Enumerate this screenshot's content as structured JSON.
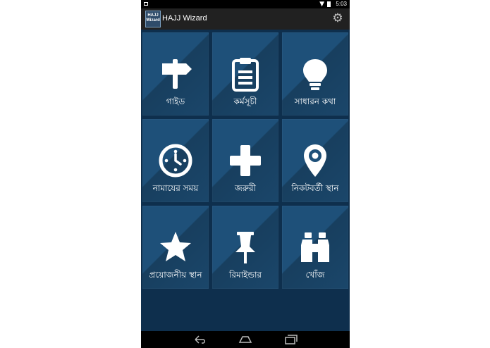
{
  "status_bar": {
    "time": "5:03"
  },
  "action_bar": {
    "logo_text": "HAJJ Wizard",
    "title": "HAJJ Wizard",
    "settings_icon": "gear-icon"
  },
  "tiles": [
    {
      "label": "গাইড",
      "icon": "signpost-icon"
    },
    {
      "label": "কর্মসূচী",
      "icon": "clipboard-icon"
    },
    {
      "label": "সাধারন কথা",
      "icon": "lightbulb-icon"
    },
    {
      "label": "নামাযের সময়",
      "icon": "clock-icon"
    },
    {
      "label": "জরুরী",
      "icon": "plus-icon"
    },
    {
      "label": "নিকটবর্তী স্থান",
      "icon": "location-pin-icon"
    },
    {
      "label": "প্রয়োজনীয় স্থান",
      "icon": "star-icon"
    },
    {
      "label": "রিমাইন্ডার",
      "icon": "pushpin-icon"
    },
    {
      "label": "খোঁজ",
      "icon": "binoculars-icon"
    }
  ],
  "nav_bar": {
    "buttons": [
      "back-icon",
      "home-icon",
      "recent-apps-icon"
    ]
  },
  "colors": {
    "background": "#0e2f4d",
    "tile": "#1e5079",
    "action_bar": "#212121"
  }
}
